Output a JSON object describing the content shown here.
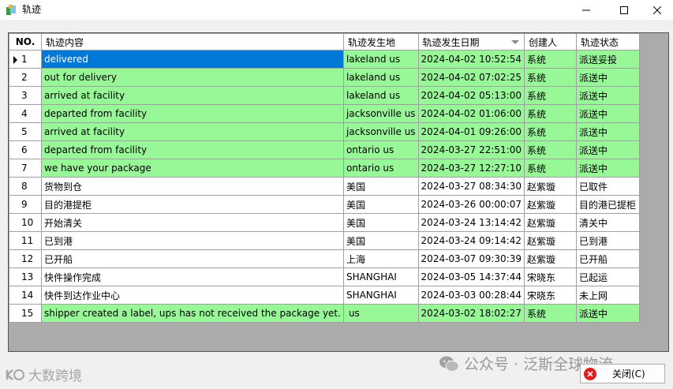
{
  "window": {
    "title": "轨迹"
  },
  "columns": [
    "NO.",
    "轨迹内容",
    "轨迹发生地",
    "轨迹发生日期",
    "创建人",
    "轨迹状态"
  ],
  "rows": [
    {
      "no": "1",
      "content": "delivered",
      "place": "lakeland us",
      "date": "2024-04-02 10:52:54",
      "creator": "系统",
      "status": "派送妥投",
      "color": "green"
    },
    {
      "no": "2",
      "content": "out for delivery",
      "place": "lakeland us",
      "date": "2024-04-02 07:02:25",
      "creator": "系统",
      "status": "派送中",
      "color": "green"
    },
    {
      "no": "3",
      "content": "arrived at facility",
      "place": "lakeland us",
      "date": "2024-04-02 05:13:00",
      "creator": "系统",
      "status": "派送中",
      "color": "green"
    },
    {
      "no": "4",
      "content": "departed from facility",
      "place": "jacksonville us",
      "date": "2024-04-02 01:06:00",
      "creator": "系统",
      "status": "派送中",
      "color": "green"
    },
    {
      "no": "5",
      "content": "arrived at facility",
      "place": "jacksonville us",
      "date": "2024-04-01 09:26:00",
      "creator": "系统",
      "status": "派送中",
      "color": "green"
    },
    {
      "no": "6",
      "content": "departed from facility",
      "place": "ontario us",
      "date": "2024-03-27 22:51:00",
      "creator": "系统",
      "status": "派送中",
      "color": "green"
    },
    {
      "no": "7",
      "content": "we have your package",
      "place": "ontario us",
      "date": "2024-03-27 12:27:10",
      "creator": "系统",
      "status": "派送中",
      "color": "green"
    },
    {
      "no": "8",
      "content": "货物到仓",
      "place": "美国",
      "date": "2024-03-27 08:34:30",
      "creator": "赵紫璇",
      "status": "已取件",
      "color": "white"
    },
    {
      "no": "9",
      "content": "目的港提柜",
      "place": "美国",
      "date": "2024-03-26 00:00:07",
      "creator": "赵紫璇",
      "status": "目的港已提柜",
      "color": "white"
    },
    {
      "no": "10",
      "content": "开始清关",
      "place": "美国",
      "date": "2024-03-24 13:14:42",
      "creator": "赵紫璇",
      "status": "清关中",
      "color": "white"
    },
    {
      "no": "11",
      "content": "已到港",
      "place": "美国",
      "date": "2024-03-24 09:14:42",
      "creator": "赵紫璇",
      "status": "已到港",
      "color": "white"
    },
    {
      "no": "12",
      "content": "已开船",
      "place": "上海",
      "date": "2024-03-07 09:30:39",
      "creator": "赵紫璇",
      "status": "已开船",
      "color": "white"
    },
    {
      "no": "13",
      "content": "快件操作完成",
      "place": "SHANGHAI",
      "date": "2024-03-05 14:37:44",
      "creator": "宋晓东",
      "status": "已起运",
      "color": "white"
    },
    {
      "no": "14",
      "content": "快件到达作业中心",
      "place": "SHANGHAI",
      "date": "2024-03-03 00:28:44",
      "creator": "宋晓东",
      "status": "未上网",
      "color": "white"
    },
    {
      "no": "15",
      "content": "shipper created a label, ups has not received the package yet.",
      "place": "us",
      "date": "2024-03-02 18:02:27",
      "creator": "系统",
      "status": "派送中",
      "color": "green"
    }
  ],
  "selected_row": 0,
  "close_button": {
    "label": "关闭(C)"
  },
  "watermarks": {
    "left": "大数跨境",
    "right": "公众号 · 泛斯全球物流"
  },
  "colors": {
    "row_green": "#98f898",
    "selection": "#0078d7",
    "grid_bg": "#ababab"
  }
}
